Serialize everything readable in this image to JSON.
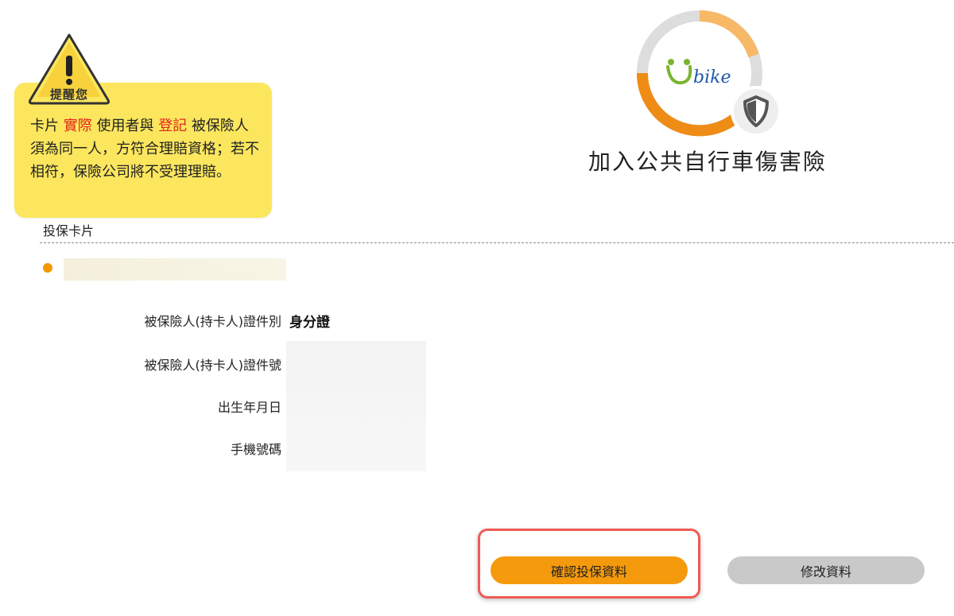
{
  "reminder": {
    "badge": "提醒您",
    "line_parts": [
      "卡片 ",
      "實際",
      " 使用者與 ",
      "登記",
      " 被保險人須為同一人，方符合理賠資格；若不相符，保險公司將不受理理賠。"
    ],
    "highlight_color": "#e0251b",
    "background_color": "#fbe65e"
  },
  "logo": {
    "brand_text": "bike"
  },
  "header": {
    "title": "加入公共自行車傷害險"
  },
  "card_section": {
    "label": "投保卡片"
  },
  "fields": [
    {
      "label": "被保險人(持卡人)證件別",
      "value": "身分證"
    },
    {
      "label": "被保險人(持卡人)證件號",
      "value": ""
    },
    {
      "label": "出生年月日",
      "value": ""
    },
    {
      "label": "手機號碼",
      "value": ""
    }
  ],
  "actions": {
    "confirm_label": "確認投保資料",
    "edit_label": "修改資料",
    "confirm_color": "#f59a0c",
    "edit_color": "#c9c9c9"
  },
  "icons": {
    "warning": "warning-icon",
    "shield": "shield-icon",
    "card_bullet": "bullet-dot-icon"
  }
}
